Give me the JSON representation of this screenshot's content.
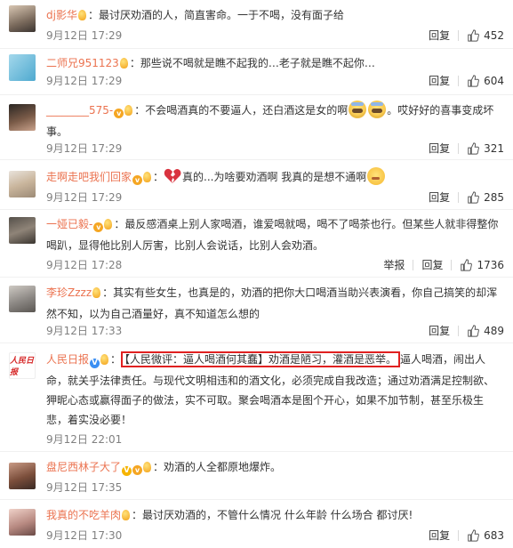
{
  "labels": {
    "reply": "回复",
    "report": "举报"
  },
  "comments": [
    {
      "name": "dj影华",
      "badges": [
        "bulb"
      ],
      "text": "最讨厌劝酒的人，简直害命。一于不喝，没有面子给",
      "time": "9月12日 17:29",
      "likes": "452"
    },
    {
      "name": "二师兄951123",
      "badges": [
        "bulb"
      ],
      "text": "那些说不喝就是瞧不起我的…老子就是瞧不起你…",
      "time": "9月12日 17:29",
      "likes": "604"
    },
    {
      "name": "________575-",
      "badges": [
        "vip",
        "bulb"
      ],
      "text_before": "不会喝酒真的不要逼人，还白酒这是女的啊",
      "text_after": "。哎好好的喜事变成坏事。",
      "time": "9月12日 17:29",
      "likes": "321"
    },
    {
      "name": "走啊走吧我们回家",
      "badges": [
        "vip",
        "bulb"
      ],
      "text_before": "真的...为啥要劝酒啊 我真的是想不通啊",
      "time": "9月12日 17:29",
      "likes": "285"
    },
    {
      "name": "一娅已毅-",
      "badges": [
        "vip",
        "bulb"
      ],
      "text": "最反感酒桌上别人家喝酒，谁爱喝就喝，喝不了喝茶也行。但某些人就非得整你喝趴，显得他比别人厉害，比别人会说话，比别人会劝酒。",
      "time": "9月12日 17:28",
      "likes": "1736",
      "has_report": true
    },
    {
      "name": "李珍Zzzz",
      "badges": [
        "bulb"
      ],
      "text": "其实有些女生，也真是的，劝酒的把你大口喝酒当助兴表演看，你自己搞笑的却浑然不知，以为自己酒量好，真不知道怎么想的",
      "time": "9月12日 17:33",
      "likes": "489"
    },
    {
      "name": "人民日报",
      "badges": [
        "v",
        "bulb"
      ],
      "highlight": "【人民微评：逼人喝酒何其蠢】劝酒是陋习，灌酒是恶举。",
      "text": "逼人喝酒，闹出人命，就关乎法律责任。与现代文明相违和的酒文化，必须完成自我改造；通过劝酒满足控制欲、狎昵心态或赢得面子的做法，实不可取。聚会喝酒本是图个开心，如果不加节制，甚至乐极生悲，着实没必要！",
      "avatar_text": "人民日报",
      "time": "9月12日 22:01",
      "likes": "",
      "has_report": false
    },
    {
      "name": "盘尼西林子大了",
      "badges": [
        "vy",
        "vip",
        "bulb"
      ],
      "text": "劝酒的人全都原地爆炸。",
      "time": "9月12日 17:35",
      "likes": ""
    },
    {
      "name": "我真的不吃羊肉",
      "badges": [
        "bulb"
      ],
      "text": "最讨厌劝酒的，不管什么情况 什么年龄 什么场合 都讨厌!",
      "time": "9月12日 17:30",
      "likes": "683"
    }
  ],
  "colors": {
    "name": "#eb7350",
    "highlight_border": "#e02020",
    "meta": "#808080"
  }
}
